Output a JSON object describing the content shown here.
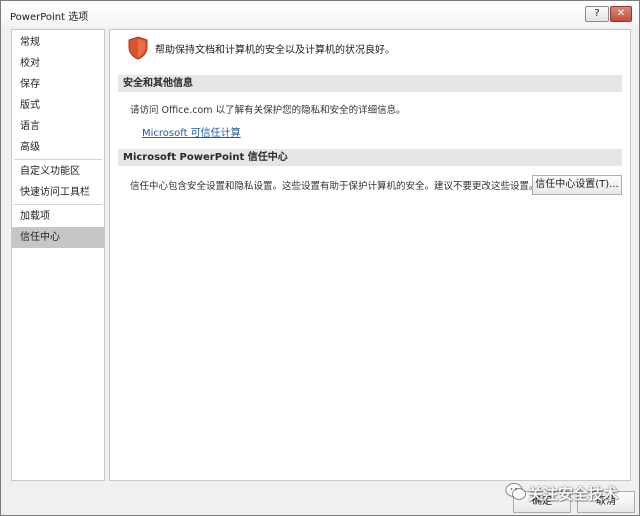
{
  "window": {
    "title": "PowerPoint 选项",
    "help_label": "?",
    "close_label": "✕"
  },
  "sidebar": {
    "items": [
      {
        "label": "常规"
      },
      {
        "label": "校对"
      },
      {
        "label": "保存"
      },
      {
        "label": "版式"
      },
      {
        "label": "语言"
      },
      {
        "label": "高级"
      },
      {
        "label": "自定义功能区"
      },
      {
        "label": "快速访问工具栏"
      },
      {
        "label": "加载项"
      },
      {
        "label": "信任中心",
        "selected": true
      }
    ]
  },
  "main": {
    "shield_icon": "shield-icon",
    "headline": "帮助保持文档和计算机的安全以及计算机的状况良好。",
    "section1": {
      "header": "安全和其他信息",
      "text": "请访问 Office.com 以了解有关保护您的隐私和安全的详细信息。",
      "link": "Microsoft 可信任计算"
    },
    "section2": {
      "header": "Microsoft PowerPoint 信任中心",
      "text": "信任中心包含安全设置和隐私设置。这些设置有助于保护计算机的安全。建议不要更改这些设置。",
      "button": "信任中心设置(T)..."
    }
  },
  "footer": {
    "ok_label": "确定",
    "cancel_label": "取消"
  },
  "watermark": {
    "text": "关注安全技术"
  },
  "colors": {
    "shield": "#d9532b",
    "link": "#1f5fa8",
    "selected_nav": "#c6c6c6",
    "section_header_bg": "#e6e6e6"
  }
}
